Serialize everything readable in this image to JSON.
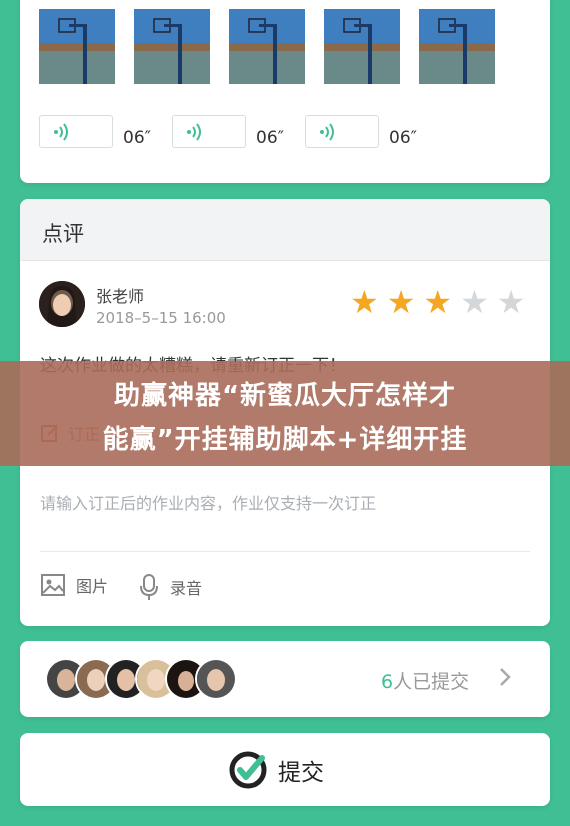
{
  "photos": [
    {
      "alt": "basketball-hoop-photo"
    },
    {
      "alt": "basketball-hoop-photo"
    },
    {
      "alt": "basketball-hoop-photo"
    },
    {
      "alt": "basketball-hoop-photo"
    },
    {
      "alt": "basketball-hoop-photo"
    }
  ],
  "voices": [
    {
      "duration": "06″"
    },
    {
      "duration": "06″"
    },
    {
      "duration": "06″"
    }
  ],
  "review": {
    "title": "点评",
    "teacher_name": "张老师",
    "time": "2018–5–15 16:00",
    "rating": 3,
    "rating_max": 5,
    "text": "这次作业做的太糟糕，请重新订正一下！",
    "revise_label": "订正",
    "input_placeholder": "请输入订正后的作业内容，作业仅支持一次订正",
    "image_label": "图片",
    "audio_label": "录音"
  },
  "banner": {
    "line1": "助赢神器“新蜜瓜大厅怎样才",
    "line2": "能赢”开挂辅助脚本+详细开挂"
  },
  "submitted": {
    "count": "6",
    "label": "人已提交"
  },
  "submit": {
    "label": "提交"
  },
  "colors": {
    "background": "#3fbf93",
    "accent": "#3fbf93",
    "star": "#f5a623",
    "warning": "#e2513b"
  }
}
